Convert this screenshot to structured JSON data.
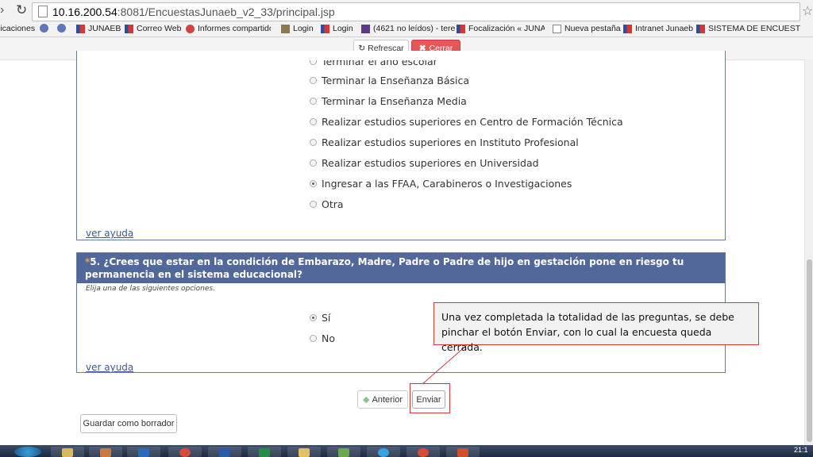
{
  "browser": {
    "url_host": "10.16.200.54",
    "url_rest": ":8081/EncuestasJunaeb_v2_33/principal.jsp",
    "bookmarks": [
      "licaciones",
      "JUNAEB",
      "Correo Web",
      "Informes compartidos",
      "Login",
      "Login",
      "(4621 no leídos) - tere",
      "Focalización « JUNAEB",
      "Nueva pestaña",
      "Intranet Junaeb",
      "SISTEMA DE ENCUEST"
    ]
  },
  "toolbar": {
    "refresh_label": "Refrescar",
    "close_label": "Cerrar"
  },
  "question4": {
    "options": [
      "Terminar el año escolar",
      "Terminar la Enseñanza Básica",
      "Terminar la Enseñanza Media",
      "Realizar estudios superiores en Centro de Formación Técnica",
      "Realizar estudios superiores en Instituto Profesional",
      "Realizar estudios superiores en Universidad",
      "Ingresar a las FFAA, Carabineros o Investigaciones",
      "Otra"
    ],
    "selected": "Ingresar a las FFAA, Carabineros o Investigaciones",
    "help_link": "ver ayuda"
  },
  "question5": {
    "required_mark": "*",
    "title": "5. ¿Crees que estar en la condición de Embarazo, Madre, Padre o Padre de hijo en gestación pone en riesgo tu permanencia en el sistema educacional?",
    "hint": "Elija una de las siguientes opciones.",
    "options": [
      "Sí",
      "No"
    ],
    "selected": "Sí",
    "help_link": "ver ayuda"
  },
  "callout": {
    "text": "Una vez completada la totalidad de las preguntas, se debe pinchar el botón Enviar, con lo cual la encuesta queda cerrada."
  },
  "nav": {
    "prev_label": "Anterior",
    "send_label": "Enviar",
    "draft_label": "Guardar como borrador"
  },
  "taskbar": {
    "clock": "21:1"
  },
  "colors": {
    "question_header": "#52689a",
    "callout_border": "#d43a3a",
    "close_button": "#e55656"
  }
}
